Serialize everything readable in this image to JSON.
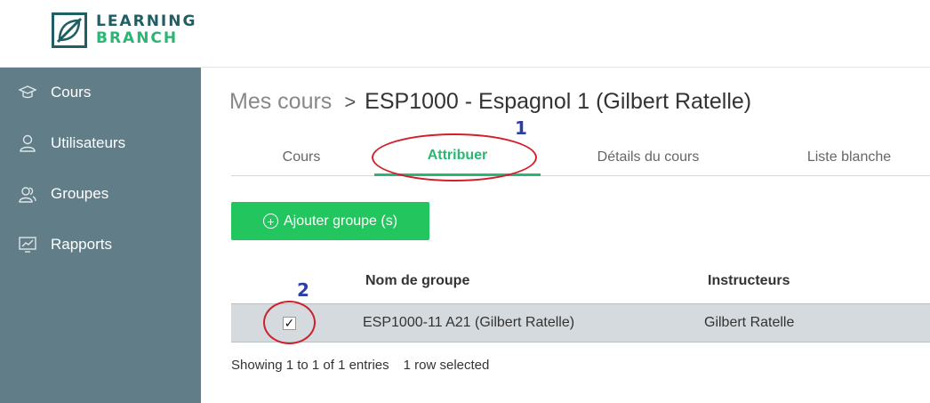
{
  "logo": {
    "line1": "LEARNING",
    "line2": "BRANCH"
  },
  "sidebar": {
    "items": [
      {
        "label": "Cours",
        "icon": "graduation-cap-icon"
      },
      {
        "label": "Utilisateurs",
        "icon": "user-icon"
      },
      {
        "label": "Groupes",
        "icon": "users-icon"
      },
      {
        "label": "Rapports",
        "icon": "chart-icon"
      }
    ]
  },
  "breadcrumb": {
    "root": "Mes cours",
    "separator": ">",
    "current": "ESP1000 - Espagnol 1 (Gilbert Ratelle)"
  },
  "tabs": [
    {
      "label": "Cours",
      "active": false
    },
    {
      "label": "Attribuer",
      "active": true
    },
    {
      "label": "Détails du cours",
      "active": false
    },
    {
      "label": "Liste blanche",
      "active": false
    }
  ],
  "annotations": {
    "marker1": "1",
    "marker2": "2",
    "color": "#d0202a",
    "number_color": "#2e3ea8"
  },
  "add_button": {
    "icon": "plus-circle-icon",
    "label": "Ajouter groupe (s)"
  },
  "table": {
    "columns": [
      "Nom de groupe",
      "Instructeurs"
    ],
    "rows": [
      {
        "checked": "✓",
        "group": "ESP1000-11 A21 (Gilbert Ratelle)",
        "instructor": "Gilbert Ratelle"
      }
    ]
  },
  "footer": {
    "entries": "Showing 1 to 1 of 1 entries",
    "selection": "1 row selected"
  },
  "colors": {
    "brand_green": "#2bb673",
    "brand_teal": "#1f5e63",
    "sidebar_bg": "#617d88",
    "button_bg": "#22c55e"
  }
}
